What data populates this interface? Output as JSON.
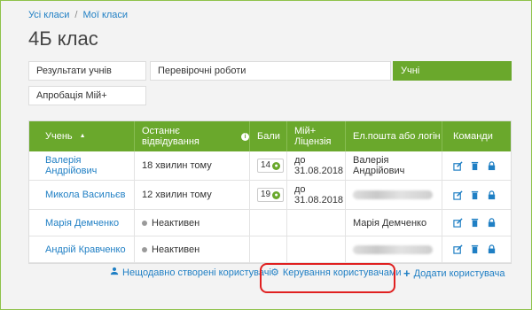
{
  "breadcrumb": {
    "item1": "Усі класи",
    "separator": "/",
    "item2": "Мої класи"
  },
  "page_title": "4Б клас",
  "tabs": [
    {
      "label": "Результати учнів"
    },
    {
      "label": "Перевірочні роботи"
    },
    {
      "label": "Учні"
    },
    {
      "label": "Апробація Мій+"
    }
  ],
  "table": {
    "headers": {
      "student": "Учень",
      "last_visit": "Останнє відвідування",
      "points": "Бали",
      "license": "Мій+ Ліцензія",
      "login": "Ел.пошта або логін",
      "commands": "Команди"
    },
    "rows": [
      {
        "name": "Валерія Андрійович",
        "last_visit": "18 хвилин тому",
        "points": "14",
        "license": "до 31.08.2018",
        "login": "Валерія Андрійович"
      },
      {
        "name": "Микола Васильєв",
        "last_visit": "12 хвилин тому",
        "points": "19",
        "license": "до 31.08.2018",
        "login": ""
      },
      {
        "name": "Марія Демченко",
        "last_visit": "Неактивен",
        "points": "",
        "license": "",
        "login": "Марія Демченко"
      },
      {
        "name": "Андрій Кравченко",
        "last_visit": "Неактивен",
        "points": "",
        "license": "",
        "login": ""
      }
    ]
  },
  "footer": {
    "recent_users": "Нещодавно створені користувачі",
    "manage_users": "Керування користувачами",
    "add_user": "Додати користувача"
  },
  "colors": {
    "accent": "#6aa82c",
    "link": "#1f7fc4",
    "highlight": "#e02020"
  }
}
